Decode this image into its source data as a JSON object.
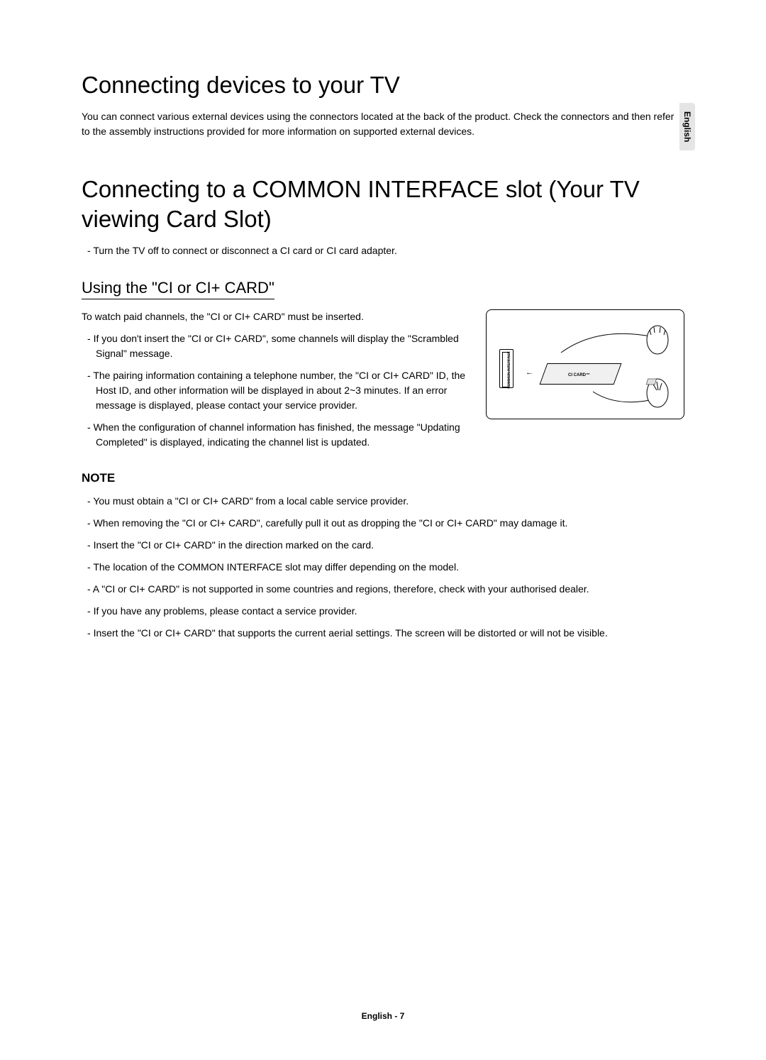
{
  "sideTab": "English",
  "section1": {
    "title": "Connecting devices to your TV",
    "intro": "You can connect various external devices using the connectors located at the back of the product. Check the connectors and then refer to the assembly instructions provided for more information on supported external devices."
  },
  "section2": {
    "title": "Connecting to a COMMON INTERFACE slot (Your TV viewing Card Slot)",
    "subPoint": "Turn the TV off to connect or disconnect a CI card or CI card adapter."
  },
  "section3": {
    "title": "Using the \"CI or CI+ CARD\"",
    "intro": "To watch paid channels, the \"CI or CI+ CARD\" must be inserted.",
    "bullets": [
      "If you don't insert the \"CI or CI+ CARD\", some channels will display the \"Scrambled Signal\" message.",
      "The pairing information containing a telephone number, the \"CI or CI+ CARD\" ID, the Host ID, and other information will be displayed in about 2~3 minutes. If an error message is displayed, please contact your service provider.",
      "When the configuration of channel information has finished, the message \"Updating Completed\" is displayed, indicating the channel list is updated."
    ]
  },
  "diagram": {
    "slotLabel": "COMMON INTERFACE",
    "cardLabel": "CI CARD™"
  },
  "noteSection": {
    "title": "NOTE",
    "bullets": [
      "You must obtain a \"CI or CI+ CARD\" from a local cable service provider.",
      "When removing the \"CI or CI+ CARD\", carefully pull it out as dropping the \"CI or CI+ CARD\" may damage it.",
      "Insert the \"CI or CI+ CARD\" in the direction marked on the card.",
      "The location of the COMMON INTERFACE slot may differ depending on the model.",
      "A \"CI or CI+ CARD\" is not supported in some countries and regions, therefore, check with your authorised dealer.",
      "If you have any problems, please contact a service provider.",
      "Insert the \"CI or CI+ CARD\" that supports the current aerial settings. The screen will be distorted or will not be visible."
    ]
  },
  "footer": "English - 7"
}
